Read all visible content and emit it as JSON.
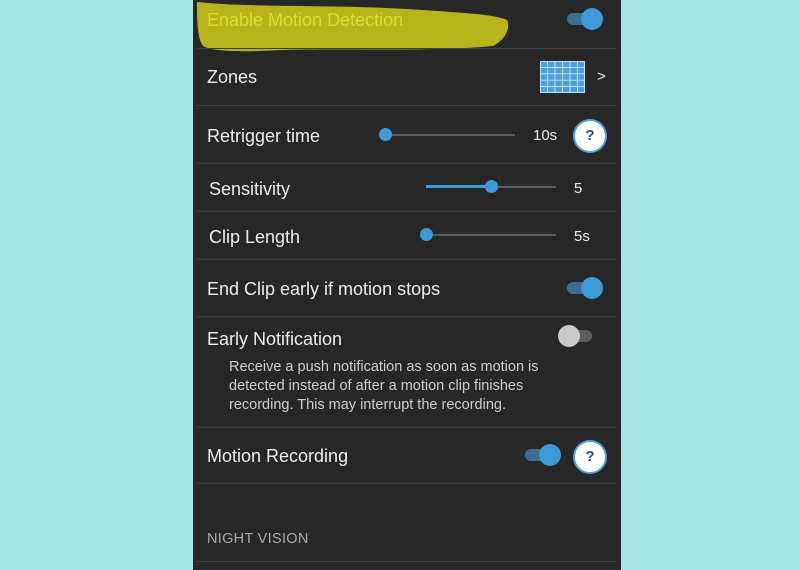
{
  "settings": {
    "motion_detection": {
      "label": "Enable Motion Detection",
      "enabled": true
    },
    "zones": {
      "label": "Zones",
      "chevron": ">"
    },
    "retrigger": {
      "label": "Retrigger time",
      "value": "10s",
      "level": 0.0,
      "help": "?"
    },
    "sensitivity": {
      "label": "Sensitivity",
      "value": "5",
      "level": 0.5
    },
    "clip_length": {
      "label": "Clip Length",
      "value": "5s",
      "level": 0.0
    },
    "end_clip_early": {
      "label": "End Clip early if motion stops",
      "enabled": true
    },
    "early_notification": {
      "label": "Early Notification",
      "enabled": false,
      "description": "Receive a push notification as soon as motion is detected instead of after a motion clip finishes recording. This may interrupt the recording."
    },
    "motion_recording": {
      "label": "Motion Recording",
      "enabled": true,
      "help": "?"
    },
    "night_vision_header": "NIGHT VISION"
  },
  "colors": {
    "accent": "#3b9ad7",
    "panel_bg": "#272727",
    "page_bg": "#a6e6e6",
    "highlight": "#b6b41a"
  }
}
